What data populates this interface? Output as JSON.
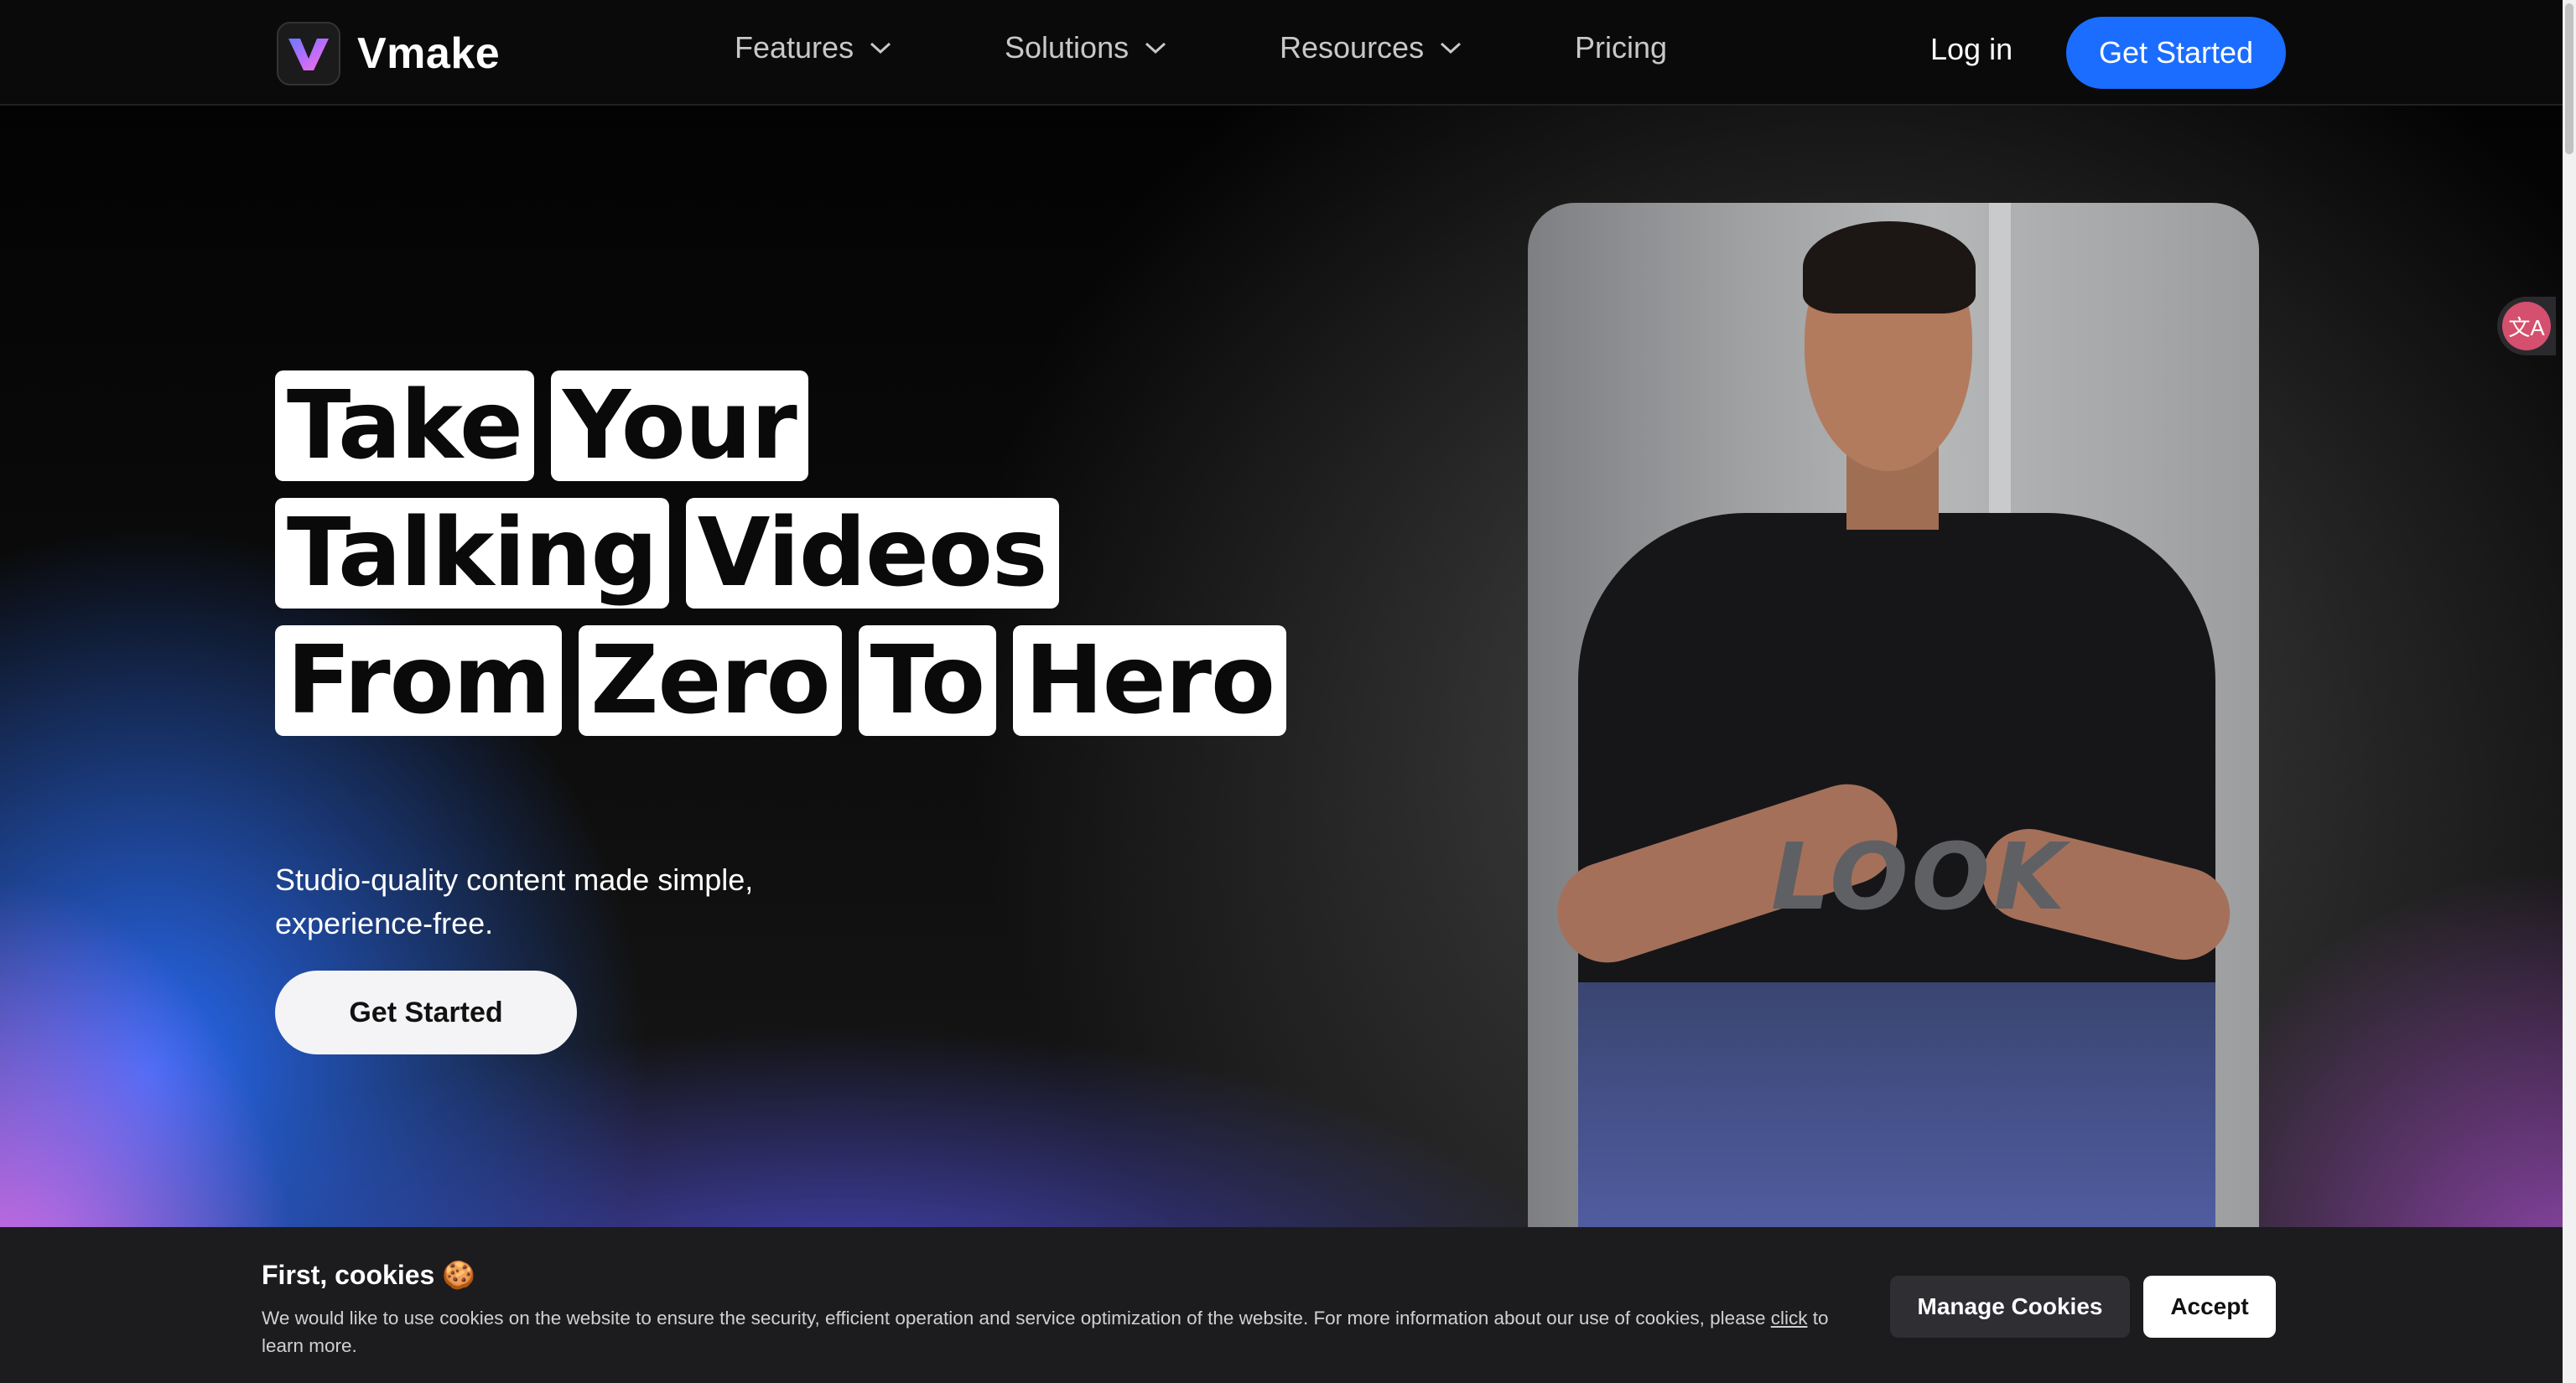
{
  "nav": {
    "brand": "Vmake",
    "items": [
      {
        "label": "Features",
        "has_dropdown": true
      },
      {
        "label": "Solutions",
        "has_dropdown": true
      },
      {
        "label": "Resources",
        "has_dropdown": true
      },
      {
        "label": "Pricing",
        "has_dropdown": false
      }
    ],
    "login_label": "Log in",
    "cta_label": "Get Started"
  },
  "hero": {
    "headline_rows": [
      [
        "Take",
        "Your"
      ],
      [
        "Talking",
        "Videos"
      ],
      [
        "From",
        "Zero",
        "To",
        "Hero"
      ]
    ],
    "subtitle": "Studio-quality content made simple, experience-free.",
    "cta_label": "Get Started"
  },
  "video": {
    "shirt_text": "LOOK"
  },
  "translate_widget": {
    "icon": "translate-icon",
    "glyph": "文A"
  },
  "cookie_banner": {
    "title": "First, cookies",
    "title_emoji": "🍪",
    "text_before_link": "We would like to use cookies on the website to ensure the security, efficient operation and service optimization of the website. For more information about our use of cookies, please ",
    "link_text": "click",
    "text_after_link": " to learn more.",
    "manage_label": "Manage Cookies",
    "accept_label": "Accept"
  },
  "colors": {
    "accent": "#1a6dff",
    "nav_bg": "#0a0a0a",
    "cookie_bg": "#1c1c1f"
  }
}
